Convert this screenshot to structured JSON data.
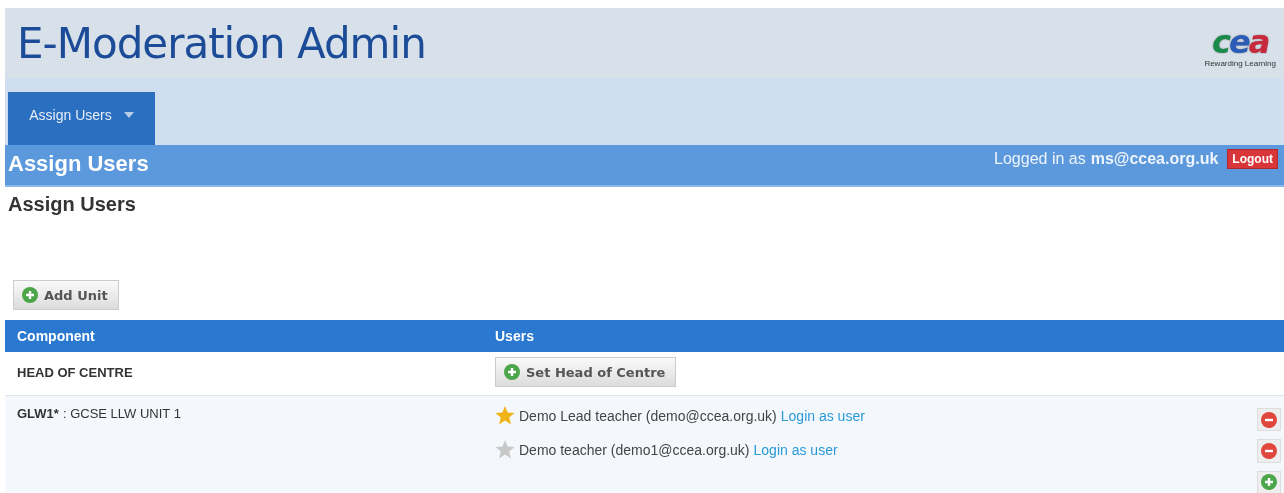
{
  "header": {
    "title": "E-Moderation Admin",
    "logo": {
      "letters": [
        "c",
        "e",
        "a"
      ],
      "tagline": "Rewarding Learning"
    }
  },
  "nav": {
    "tabs": [
      {
        "label": "Assign Users",
        "selected": true
      }
    ]
  },
  "title_bar": {
    "title": "Assign Users",
    "login_prefix": "Logged in as",
    "user": "ms@ccea.org.uk",
    "logout": "Logout"
  },
  "page_heading": "Assign Users",
  "add_unit_button": "Add Unit",
  "table": {
    "columns": [
      "Component",
      "Users"
    ],
    "rows": [
      {
        "kind": "head",
        "component": "HEAD OF CENTRE",
        "button": "Set Head of Centre"
      },
      {
        "kind": "unit",
        "code": "GLW1*",
        "name": ": GCSE LLW UNIT 1",
        "users": [
          {
            "name": "Demo Lead teacher (demo@ccea.org.uk)",
            "link": "Login as user",
            "lead": true
          },
          {
            "name": "Demo teacher (demo1@ccea.org.uk)",
            "link": "Login as user",
            "lead": false
          }
        ]
      }
    ]
  }
}
